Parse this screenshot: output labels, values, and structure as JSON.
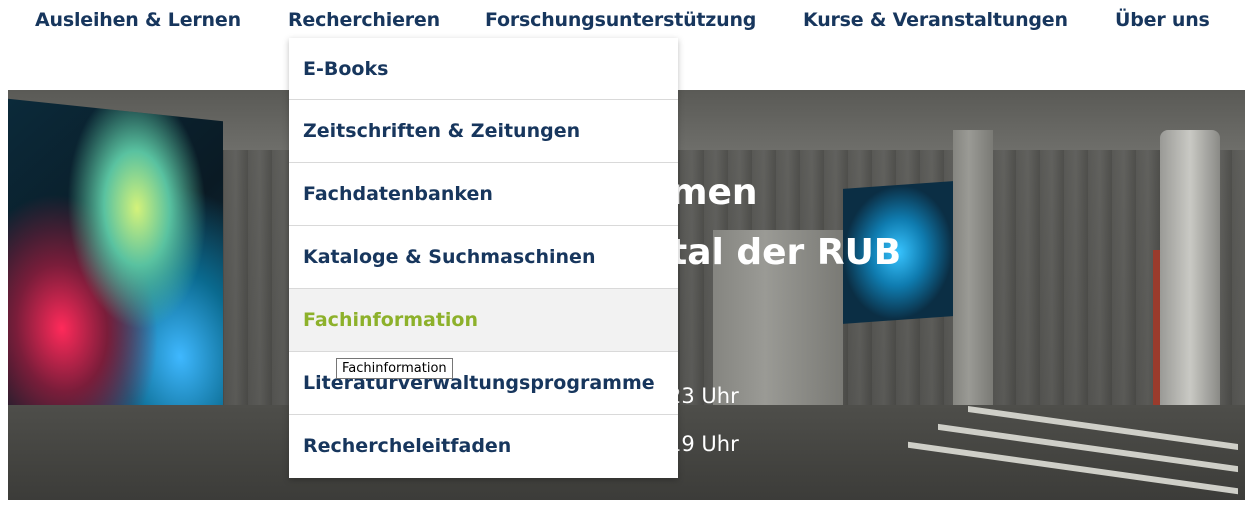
{
  "nav": {
    "items": [
      {
        "label": "Ausleihen & Lernen"
      },
      {
        "label": "Recherchieren"
      },
      {
        "label": "Forschungsunterstützung"
      },
      {
        "label": "Kurse & Veranstaltungen"
      },
      {
        "label": "Über uns"
      }
    ]
  },
  "dropdown": {
    "items": [
      {
        "label": "E-Books"
      },
      {
        "label": "Zeitschriften & Zeitungen"
      },
      {
        "label": "Fachdatenbanken"
      },
      {
        "label": "Kataloge & Suchmaschinen"
      },
      {
        "label": "Fachinformation"
      },
      {
        "label": "Literaturverwaltungsprogramme"
      },
      {
        "label": "Rechercheleitfaden"
      }
    ],
    "active_index": 4,
    "active_color": "#8db12b",
    "text_color": "#17365d"
  },
  "tooltip": {
    "text": "Fachinformation"
  },
  "hero": {
    "line1_fragment": "men",
    "line2_fragment": "tal der RUB",
    "small1_fragment": "23 Uhr",
    "small2_fragment": "19 Uhr"
  }
}
